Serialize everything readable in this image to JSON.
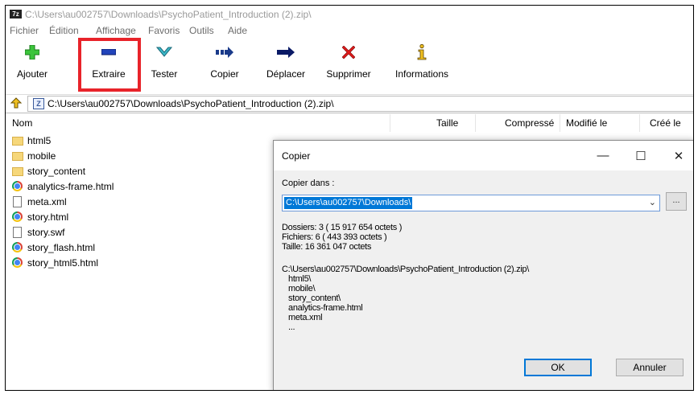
{
  "window": {
    "app_icon_label": "7z",
    "title": "C:\\Users\\au002757\\Downloads\\PsychoPatient_Introduction (2).zip\\"
  },
  "menu": [
    "Fichier",
    "Édition",
    "Affichage",
    "Favoris",
    "Outils",
    "Aide"
  ],
  "toolbar": {
    "items": [
      {
        "label": "Ajouter",
        "icon": "plus-icon"
      },
      {
        "label": "Extraire",
        "icon": "minus-icon"
      },
      {
        "label": "Tester",
        "icon": "check-icon"
      },
      {
        "label": "Copier",
        "icon": "copy-arrow-icon"
      },
      {
        "label": "Déplacer",
        "icon": "move-arrow-icon"
      },
      {
        "label": "Supprimer",
        "icon": "x-icon"
      },
      {
        "label": "Informations",
        "icon": "info-icon"
      }
    ],
    "highlight_color": "#e8232a"
  },
  "address": {
    "path": "C:\\Users\\au002757\\Downloads\\PsychoPatient_Introduction (2).zip\\"
  },
  "columns": {
    "name": "Nom",
    "size": "Taille",
    "compressed": "Compressé",
    "modified": "Modifié le",
    "created": "Créé le"
  },
  "files": [
    {
      "name": "html5",
      "type": "folder"
    },
    {
      "name": "mobile",
      "type": "folder"
    },
    {
      "name": "story_content",
      "type": "folder"
    },
    {
      "name": "analytics-frame.html",
      "type": "chrome"
    },
    {
      "name": "meta.xml",
      "type": "file"
    },
    {
      "name": "story.html",
      "type": "chrome"
    },
    {
      "name": "story.swf",
      "type": "file"
    },
    {
      "name": "story_flash.html",
      "type": "chrome"
    },
    {
      "name": "story_html5.html",
      "type": "chrome"
    }
  ],
  "dialog": {
    "title": "Copier",
    "copy_to_label": "Copier dans :",
    "destination": "C:\\Users\\au002757\\Downloads\\",
    "browse_label": "...",
    "folders_line": "Dossiers: 3   ( 15 917 654 octets )",
    "files_line": "Fichiers: 6   ( 443 393 octets )",
    "size_line": "Taille: 16 361 047 octets",
    "list": [
      "C:\\Users\\au002757\\Downloads\\PsychoPatient_Introduction (2).zip\\",
      "  html5\\",
      "  mobile\\",
      "  story_content\\",
      "  analytics-frame.html",
      "  meta.xml",
      "  ..."
    ],
    "ok_label": "OK",
    "cancel_label": "Annuler",
    "minimize_glyph": "—",
    "maximize_glyph": "☐",
    "close_glyph": "✕"
  }
}
